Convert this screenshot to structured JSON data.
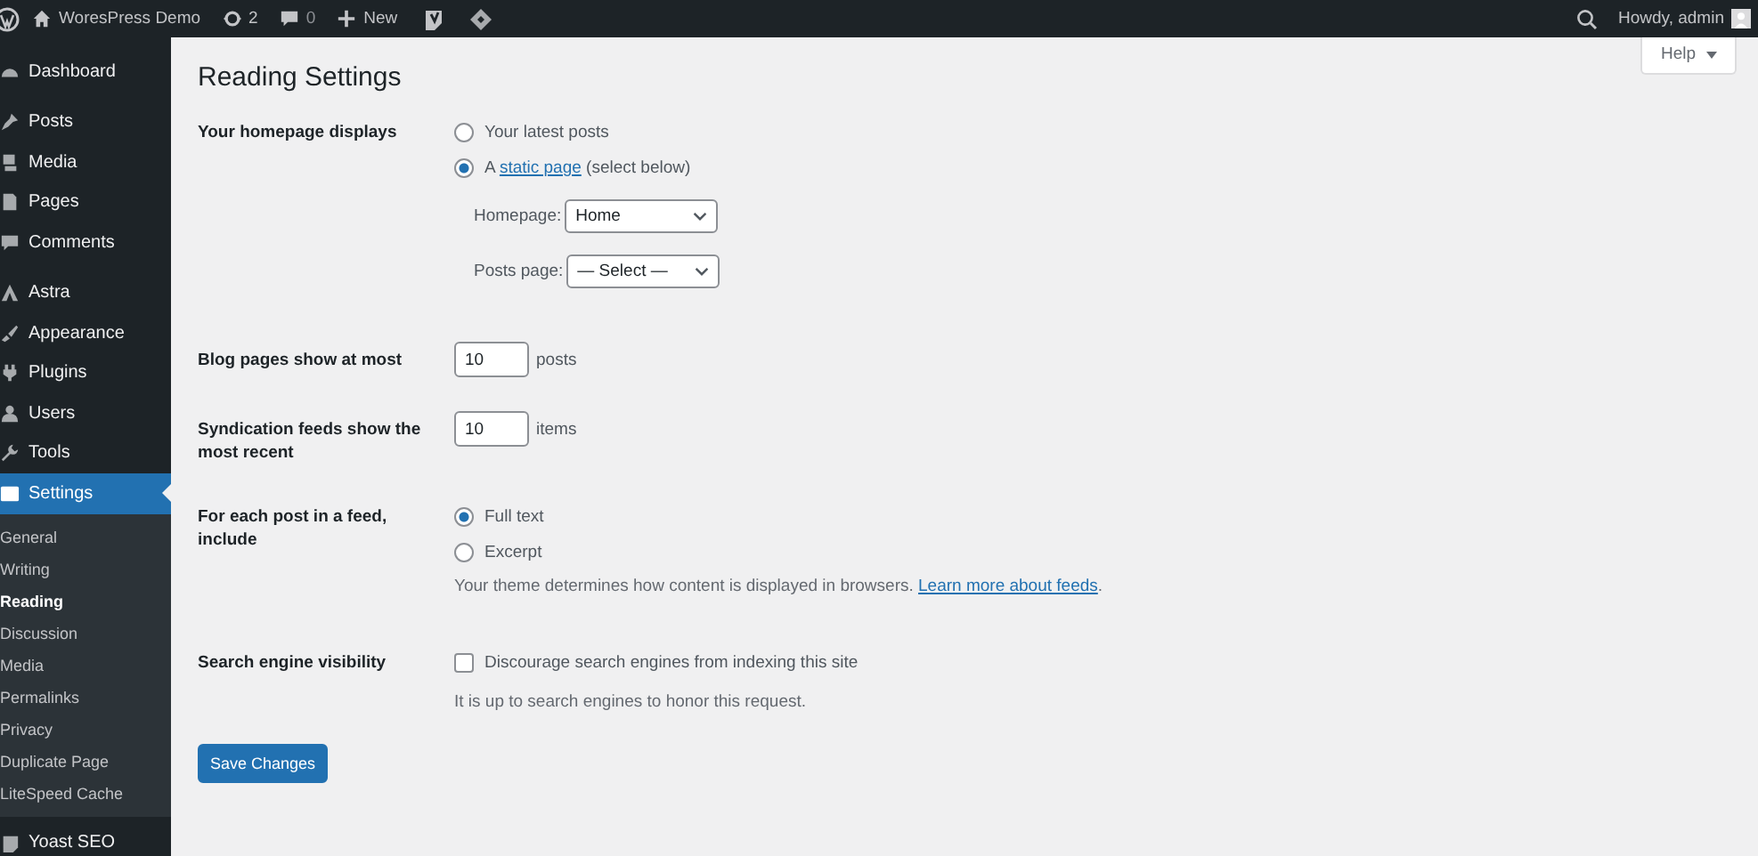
{
  "admin_bar": {
    "items": [
      {
        "kind": "logo"
      },
      {
        "kind": "site",
        "label": "WoresPress Demo"
      },
      {
        "kind": "updates",
        "label": "2"
      },
      {
        "kind": "comments",
        "label": "0"
      },
      {
        "kind": "new",
        "label": "New"
      },
      {
        "kind": "yoast"
      },
      {
        "kind": "diamond"
      }
    ],
    "greeting": "Howdy, admin"
  },
  "sidebar": {
    "groups": [
      [
        {
          "label": "Dashboard",
          "selected": false
        }
      ],
      [
        {
          "label": "Posts",
          "selected": false
        },
        {
          "label": "Media",
          "selected": false
        },
        {
          "label": "Pages",
          "selected": false
        },
        {
          "label": "Comments",
          "selected": false
        }
      ],
      [
        {
          "label": "Astra",
          "selected": false
        },
        {
          "label": "Appearance",
          "selected": false
        },
        {
          "label": "Plugins",
          "selected": false
        },
        {
          "label": "Users",
          "selected": false
        },
        {
          "label": "Tools",
          "selected": false
        },
        {
          "label": "Settings",
          "selected": true,
          "children": [
            {
              "label": "General",
              "selected": false
            },
            {
              "label": "Writing",
              "selected": false
            },
            {
              "label": "Reading",
              "selected": true
            },
            {
              "label": "Discussion",
              "selected": false
            },
            {
              "label": "Media",
              "selected": false
            },
            {
              "label": "Permalinks",
              "selected": false
            },
            {
              "label": "Privacy",
              "selected": false
            },
            {
              "label": "Duplicate Page",
              "selected": false
            },
            {
              "label": "LiteSpeed Cache",
              "selected": false
            }
          ]
        }
      ],
      [
        {
          "label": "Yoast SEO",
          "selected": false
        }
      ]
    ]
  },
  "help": {
    "label": "Help"
  },
  "title": "Reading Settings",
  "rows": [
    {
      "kind": "radio",
      "label": "Your homepage displays",
      "options": [
        {
          "before": "Your latest posts",
          "selected": false
        },
        {
          "before": "A ",
          "link": "static page",
          "after": "(select below)",
          "selected": true
        }
      ],
      "selects": [
        {
          "label": "Homepage:",
          "value": "Home"
        },
        {
          "label": "Posts page:",
          "value": "— Select —"
        }
      ]
    },
    {
      "kind": "number",
      "label": "Blog pages show at most",
      "value": "10",
      "unit": "posts"
    },
    {
      "kind": "number",
      "label": "Syndication feeds show the most recent",
      "value": "10",
      "unit": "items"
    },
    {
      "kind": "radio",
      "label": "For each post in a feed, include",
      "options": [
        {
          "before": "Full text",
          "selected": true
        },
        {
          "before": "Excerpt",
          "selected": false
        }
      ],
      "description": "Your theme determines how content is displayed in browsers.",
      "description_link": "Learn more about feeds",
      "description_end": "."
    },
    {
      "kind": "checkbox",
      "label": "Search engine visibility",
      "option": "Discourage search engines from indexing this site",
      "checked": false,
      "description": "It is up to search engines to honor this request."
    }
  ],
  "save": "Save Changes"
}
